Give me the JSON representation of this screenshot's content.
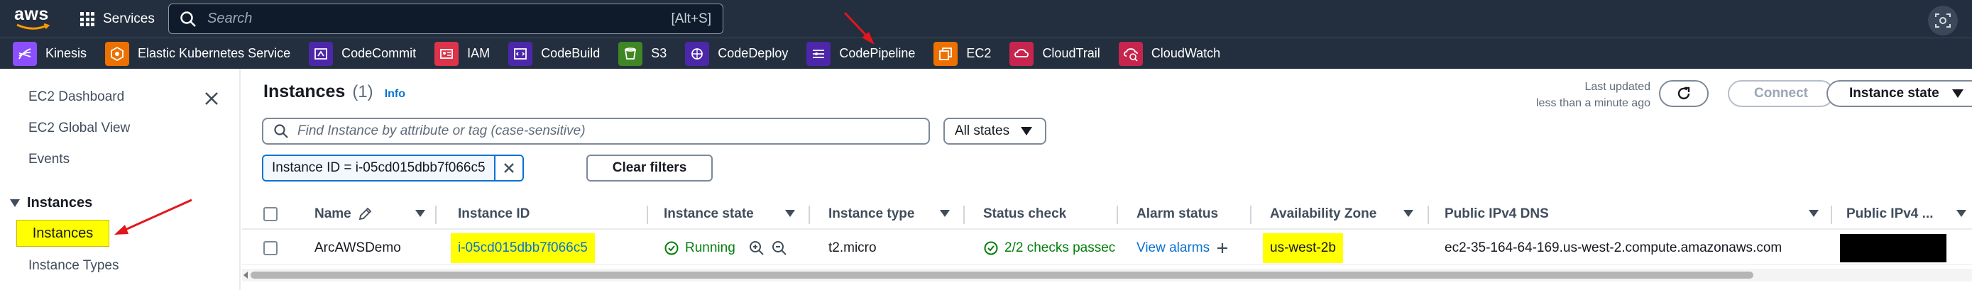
{
  "topnav": {
    "logo_text": "aws",
    "services_label": "Services",
    "search_placeholder": "Search",
    "search_shortcut": "[Alt+S]"
  },
  "favorites": [
    {
      "label": "Kinesis",
      "icon": "kinesis-icon",
      "color": "#8c4fff"
    },
    {
      "label": "Elastic Kubernetes Service",
      "icon": "eks-icon",
      "color": "#ed7100"
    },
    {
      "label": "CodeCommit",
      "icon": "codecommit-icon",
      "color": "#4d27aa"
    },
    {
      "label": "IAM",
      "icon": "iam-icon",
      "color": "#dd344c"
    },
    {
      "label": "CodeBuild",
      "icon": "codebuild-icon",
      "color": "#4d27aa"
    },
    {
      "label": "S3",
      "icon": "s3-icon",
      "color": "#3f8624"
    },
    {
      "label": "CodeDeploy",
      "icon": "codedeploy-icon",
      "color": "#4d27aa"
    },
    {
      "label": "CodePipeline",
      "icon": "codepipeline-icon",
      "color": "#4d27aa"
    },
    {
      "label": "EC2",
      "icon": "ec2-icon",
      "color": "#ed7100"
    },
    {
      "label": "CloudTrail",
      "icon": "cloudtrail-icon",
      "color": "#c7254e"
    },
    {
      "label": "CloudWatch",
      "icon": "cloudwatch-icon",
      "color": "#c7254e"
    }
  ],
  "sidebar": {
    "links": [
      "EC2 Dashboard",
      "EC2 Global View",
      "Events"
    ],
    "section": "Instances",
    "active_item": "Instances",
    "next_item": "Instance Types"
  },
  "main": {
    "title": "Instances",
    "count": "(1)",
    "info": "Info",
    "last_updated_line1": "Last updated",
    "last_updated_line2": "less than a minute ago",
    "connect_label": "Connect",
    "instance_state_label": "Instance state",
    "filter_placeholder": "Find Instance by attribute or tag (case-sensitive)",
    "states_select": "All states",
    "token": "Instance ID = i-05cd015dbb7f066c5",
    "clear_filters": "Clear filters"
  },
  "table": {
    "headers": [
      "Name",
      "Instance ID",
      "Instance state",
      "Instance type",
      "Status check",
      "Alarm status",
      "Availability Zone",
      "Public IPv4 DNS",
      "Public IPv4 ..."
    ],
    "row": {
      "name": "ArcAWSDemo",
      "instance_id": "i-05cd015dbb7f066c5",
      "state": "Running",
      "type": "t2.micro",
      "status_check": "2/2 checks passec",
      "alarm": "View alarms",
      "az": "us-west-2b",
      "dns": "ec2-35-164-64-169.us-west-2.compute.amazonaws.com"
    }
  },
  "colors": {
    "nav_bg": "#232f3e",
    "link": "#0972d3",
    "success": "#037f0c",
    "highlight": "#ffff00",
    "annotation_arrow": "#e3161b"
  }
}
